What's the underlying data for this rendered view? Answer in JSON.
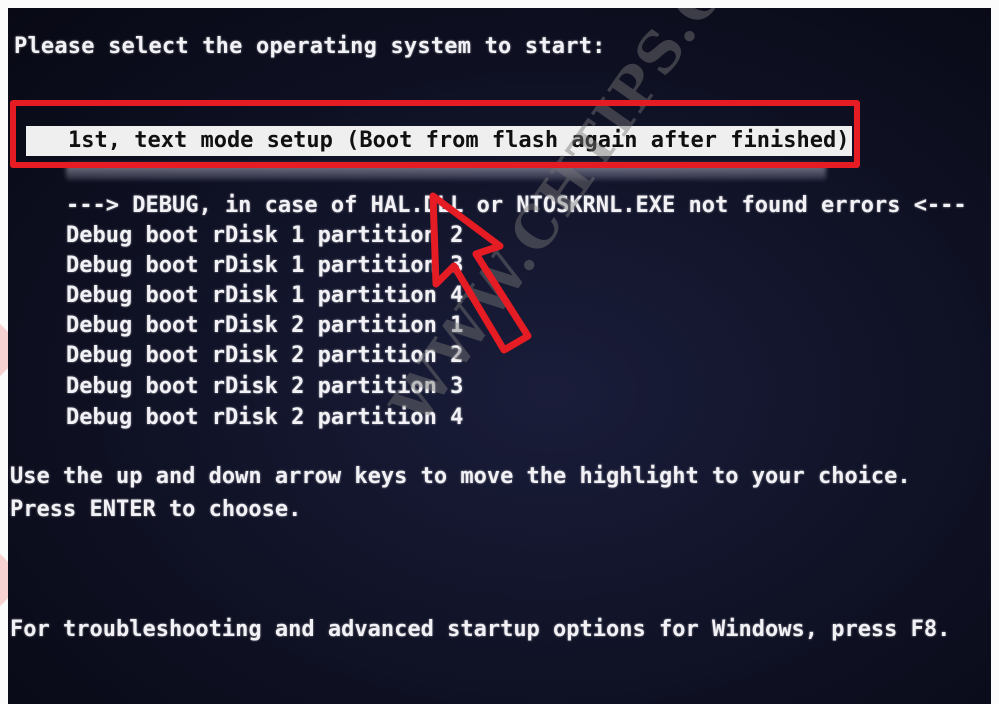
{
  "boot_menu": {
    "prompt": "Please select the operating system to start:",
    "selected_item": "1st, text mode setup (Boot from flash again after finished)",
    "debug_header": "---> DEBUG, in case of HAL.DLL or NTOSKRNL.EXE not found errors <---",
    "items": [
      "Debug boot rDisk 1 partition 2",
      "Debug boot rDisk 1 partition 3",
      "Debug boot rDisk 1 partition 4",
      "Debug boot rDisk 2 partition 1",
      "Debug boot rDisk 2 partition 2",
      "Debug boot rDisk 2 partition 3",
      "Debug boot rDisk 2 partition 4"
    ],
    "hint_navigation": "Use the up and down arrow keys to move the highlight to your choice.",
    "hint_enter": "Press ENTER to choose.",
    "footer": "For troubleshooting and advanced startup options for Windows, press F8."
  },
  "watermark": {
    "text": "WWW.CHTIPS.COM"
  },
  "annotation": {
    "color": "#e51c23",
    "icon": "arrow-pointer-icon"
  },
  "colors": {
    "screen_background": "#0f1124",
    "text": "#f2f2f6",
    "highlight_background": "#efefef",
    "highlight_text": "#101010"
  }
}
